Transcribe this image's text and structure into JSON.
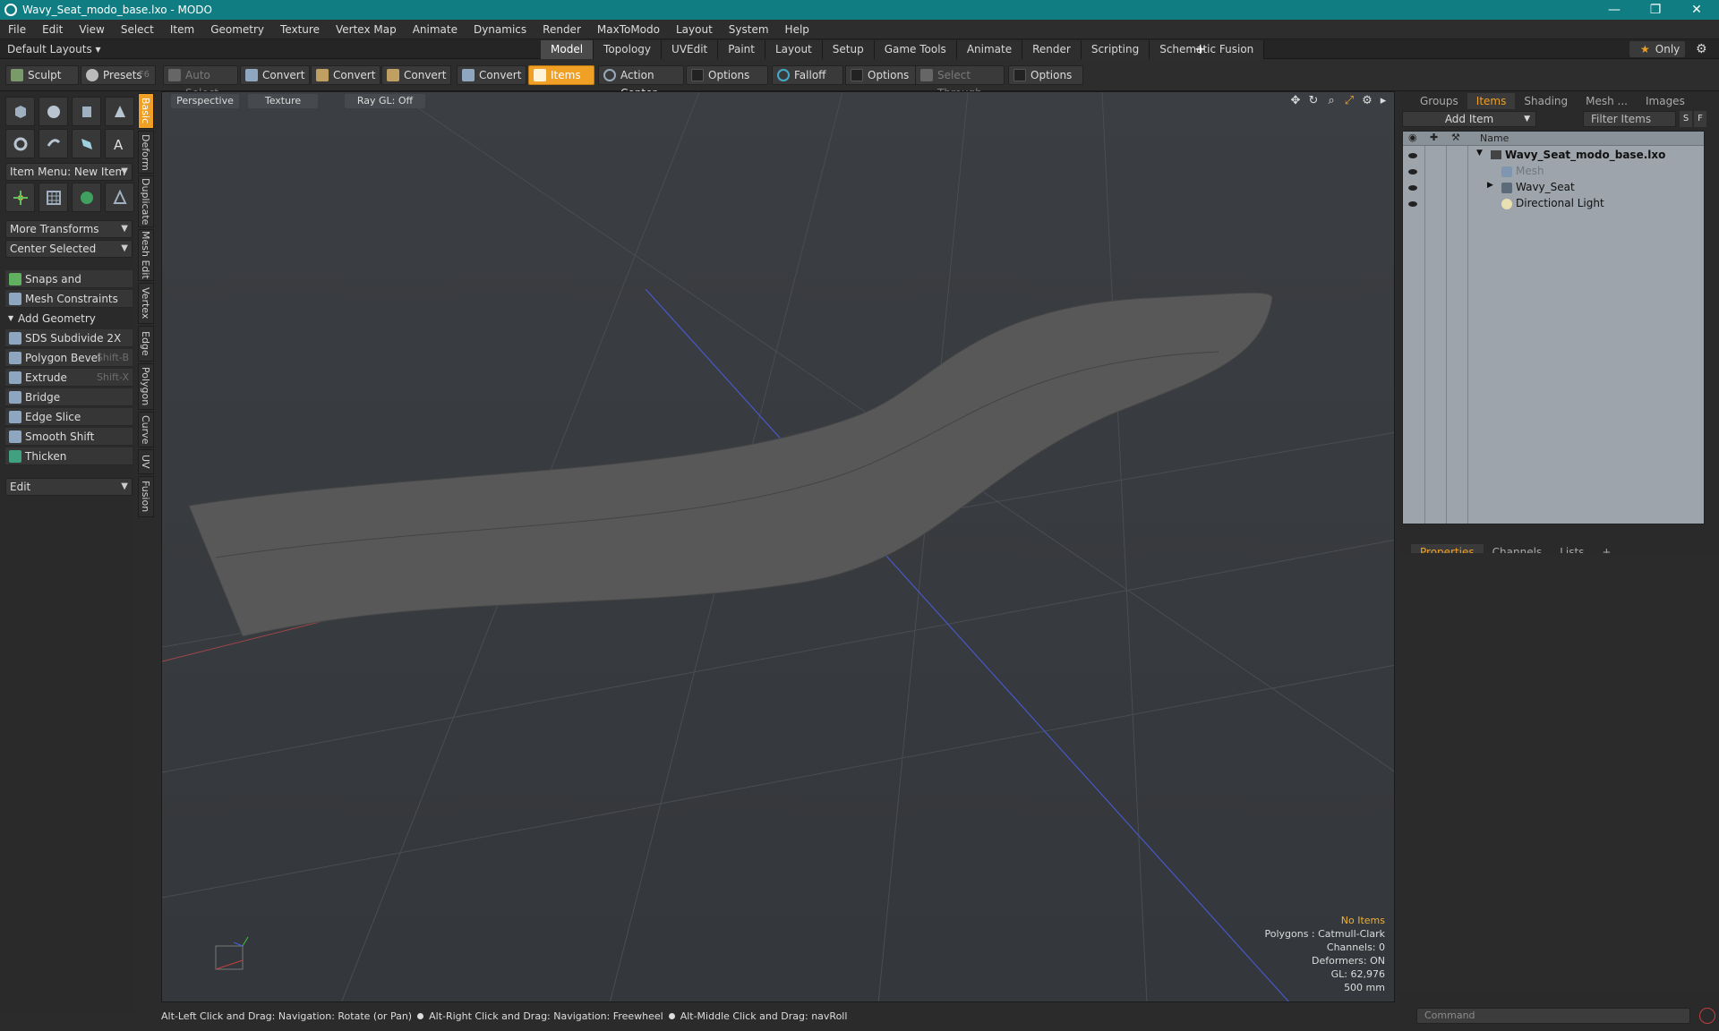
{
  "window": {
    "title": "Wavy_Seat_modo_base.lxo - MODO",
    "minimize": "—",
    "restore": "❐",
    "close": "✕"
  },
  "menu": [
    "File",
    "Edit",
    "View",
    "Select",
    "Item",
    "Geometry",
    "Texture",
    "Vertex Map",
    "Animate",
    "Dynamics",
    "Render",
    "MaxToModo",
    "Layout",
    "System",
    "Help"
  ],
  "layoutbar": {
    "default_layouts": "Default Layouts ▾",
    "tabs": [
      "Model",
      "Topology",
      "UVEdit",
      "Paint",
      "Layout",
      "Setup",
      "Game Tools",
      "Animate",
      "Render",
      "Scripting",
      "Schematic Fusion"
    ],
    "active_tab": "Model",
    "plus": "+",
    "only": "Only"
  },
  "toolbar": {
    "sculpt": "Sculpt",
    "presets": "Presets",
    "presets_key": "F6",
    "auto_select": "Auto Select",
    "convert": "Convert",
    "items": "Items",
    "action_center": "Action Center",
    "options": "Options",
    "falloff": "Falloff",
    "select_through": "Select Through"
  },
  "left": {
    "item_menu": "Item Menu: New Item",
    "more_transforms": "More Transforms",
    "center_selected": "Center Selected",
    "snaps": "Snaps and Precision",
    "mesh_constraints": "Mesh Constraints",
    "add_geometry": "Add Geometry",
    "tools": [
      {
        "label": "SDS Subdivide 2X",
        "shortcut": ""
      },
      {
        "label": "Polygon Bevel",
        "shortcut": "Shift-B"
      },
      {
        "label": "Extrude",
        "shortcut": "Shift-X"
      },
      {
        "label": "Bridge",
        "shortcut": ""
      },
      {
        "label": "Edge Slice",
        "shortcut": ""
      },
      {
        "label": "Smooth Shift",
        "shortcut": ""
      },
      {
        "label": "Thicken",
        "shortcut": ""
      }
    ],
    "edit": "Edit"
  },
  "vtabs": [
    "Basic",
    "Deform",
    "Duplicate",
    "Mesh Edit",
    "Vertex",
    "Edge",
    "Polygon",
    "Curve",
    "UV",
    "Fusion"
  ],
  "viewport": {
    "perspective": "Perspective",
    "texture": "Texture",
    "raygl": "Ray GL: Off",
    "stats": {
      "no_items": "No Items",
      "polygons": "Polygons : Catmull-Clark",
      "channels": "Channels: 0",
      "deformers": "Deformers: ON",
      "gl": "GL: 62,976",
      "size": "500 mm"
    }
  },
  "status": {
    "hint1": "Alt-Left Click and Drag: Navigation: Rotate (or Pan)",
    "hint2": "Alt-Right Click and Drag: Navigation: Freewheel",
    "hint3": "Alt-Middle Click and Drag: navRoll"
  },
  "right": {
    "tabs": [
      "Groups",
      "Items",
      "Shading",
      "Mesh ...",
      "Images"
    ],
    "active_tab": "Items",
    "add_item": "Add Item",
    "filter_items": "Filter Items",
    "s": "S",
    "f": "F",
    "name_col": "Name",
    "tree": [
      {
        "label": "Wavy_Seat_modo_base.lxo",
        "bold": true,
        "indent": 0
      },
      {
        "label": "Mesh",
        "dim": true,
        "indent": 1
      },
      {
        "label": "Wavy_Seat",
        "indent": 1
      },
      {
        "label": "Directional Light",
        "indent": 1
      }
    ],
    "prop_tabs": [
      "Properties",
      "Channels",
      "Lists"
    ],
    "command_placeholder": "Command"
  }
}
